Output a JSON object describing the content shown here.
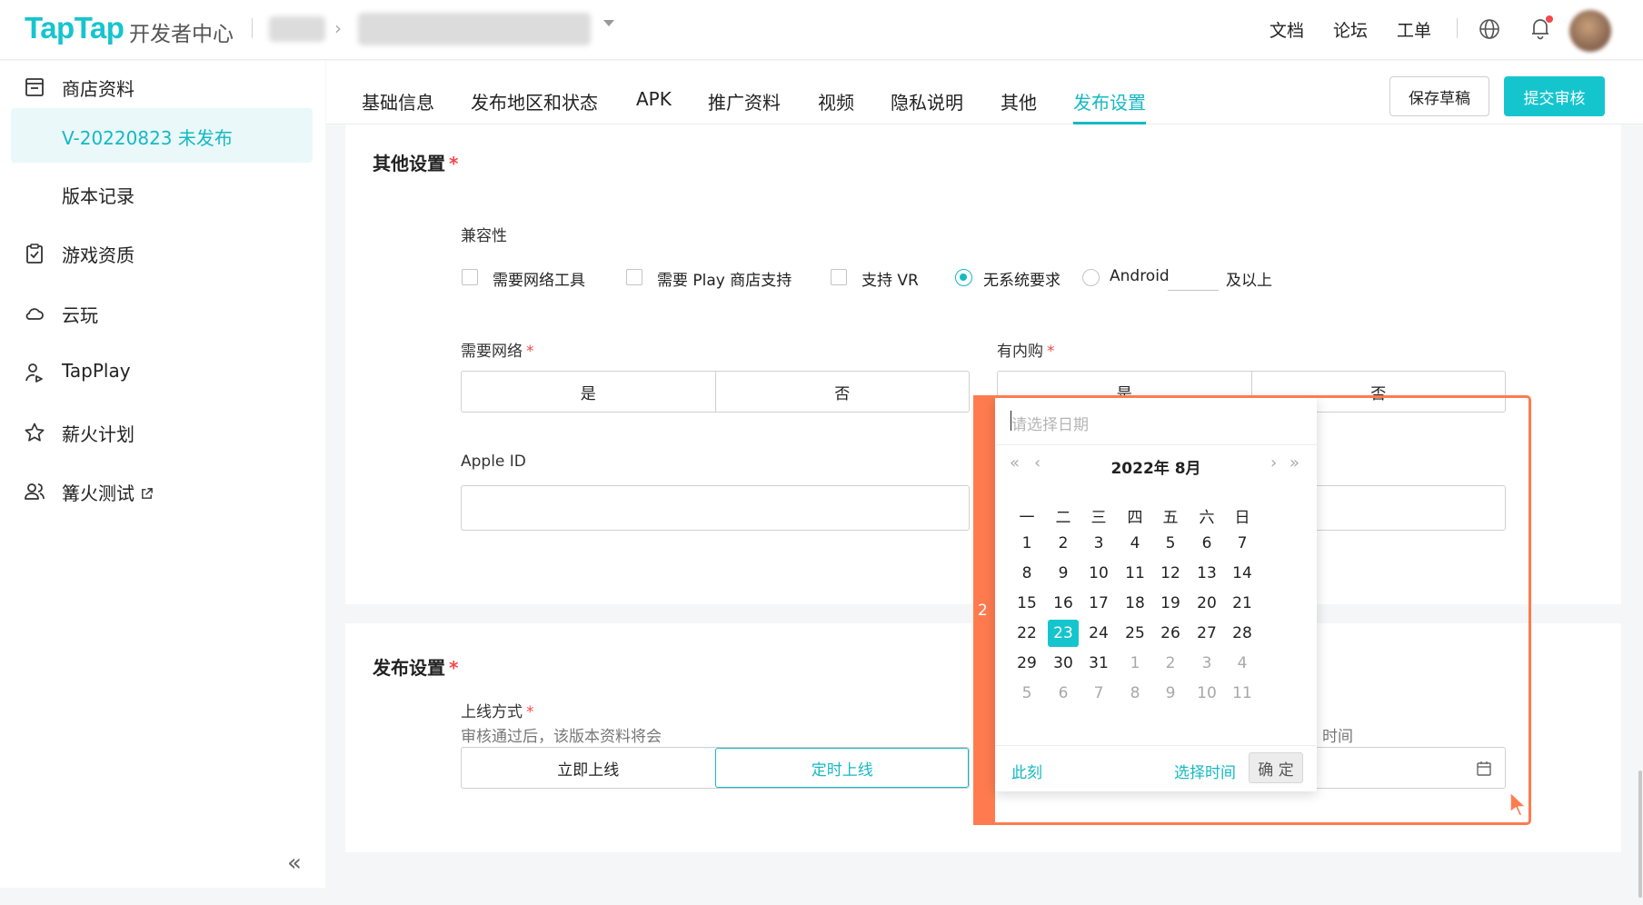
{
  "header": {
    "logo": "TapTap",
    "logo_sub": "开发者中心",
    "links": [
      "文档",
      "论坛",
      "工单"
    ]
  },
  "sidebar": {
    "items": [
      {
        "label": "商店资料",
        "icon": "store-icon"
      },
      {
        "label": "V-20220823 未发布",
        "active": true
      },
      {
        "label": "版本记录"
      },
      {
        "label": "游戏资质",
        "icon": "clipboard-check-icon"
      },
      {
        "label": "云玩",
        "icon": "cloud-icon"
      },
      {
        "label": "TapPlay",
        "icon": "tapplay-icon"
      },
      {
        "label": "薪火计划",
        "icon": "star-icon"
      },
      {
        "label": "篝火测试",
        "icon": "users-icon",
        "external": true
      }
    ]
  },
  "tabs": [
    "基础信息",
    "发布地区和状态",
    "APK",
    "推广资料",
    "视频",
    "隐私说明",
    "其他",
    "发布设置"
  ],
  "active_tab": "发布设置",
  "actions": {
    "save_draft": "保存草稿",
    "submit": "提交审核"
  },
  "other_settings": {
    "title": "其他设置",
    "required_mark": "*",
    "compat": {
      "label": "兼容性",
      "options": [
        {
          "label": "需要网络工具",
          "type": "checkbox",
          "checked": false
        },
        {
          "label": "需要 Play 商店支持",
          "type": "checkbox",
          "checked": false
        },
        {
          "label": "支持 VR",
          "type": "checkbox",
          "checked": false
        },
        {
          "label": "无系统要求",
          "type": "radio",
          "checked": true
        },
        {
          "label": "Android",
          "type": "radio",
          "checked": false
        }
      ],
      "android_suffix": "及以上"
    },
    "need_network": {
      "label": "需要网络",
      "options": [
        "是",
        "否"
      ]
    },
    "in_app_purchase": {
      "label": "有内购",
      "options": [
        "是",
        "否"
      ]
    },
    "apple_id": {
      "label": "Apple ID",
      "value": ""
    }
  },
  "publish_settings": {
    "title": "发布设置",
    "online_mode": {
      "label": "上线方式",
      "hint": "审核通过后，该版本资料将会",
      "options": [
        "立即上线",
        "定时上线"
      ],
      "selected": "定时上线"
    },
    "time_hint_fragment": "时间"
  },
  "annotation": {
    "number": "2",
    "color": "#ff7b4f"
  },
  "date_picker": {
    "placeholder": "请选择日期",
    "month_label": "2022年 8月",
    "nav": {
      "prev_year": "«",
      "prev_month": "‹",
      "next_month": "›",
      "next_year": "»"
    },
    "weekdays": [
      "一",
      "二",
      "三",
      "四",
      "五",
      "六",
      "日"
    ],
    "weeks": [
      [
        "1",
        "2",
        "3",
        "4",
        "5",
        "6",
        "7"
      ],
      [
        "8",
        "9",
        "10",
        "11",
        "12",
        "13",
        "14"
      ],
      [
        "15",
        "16",
        "17",
        "18",
        "19",
        "20",
        "21"
      ],
      [
        "22",
        "23",
        "24",
        "25",
        "26",
        "27",
        "28"
      ],
      [
        "29",
        "30",
        "31",
        "1",
        "2",
        "3",
        "4"
      ],
      [
        "5",
        "6",
        "7",
        "8",
        "9",
        "10",
        "11"
      ]
    ],
    "selected_day": "23",
    "now_label": "此刻",
    "select_time_label": "选择时间",
    "confirm_label": "确 定"
  },
  "colors": {
    "accent": "#15c5ce",
    "required": "#f5484a",
    "annotation": "#ff7b4f"
  }
}
